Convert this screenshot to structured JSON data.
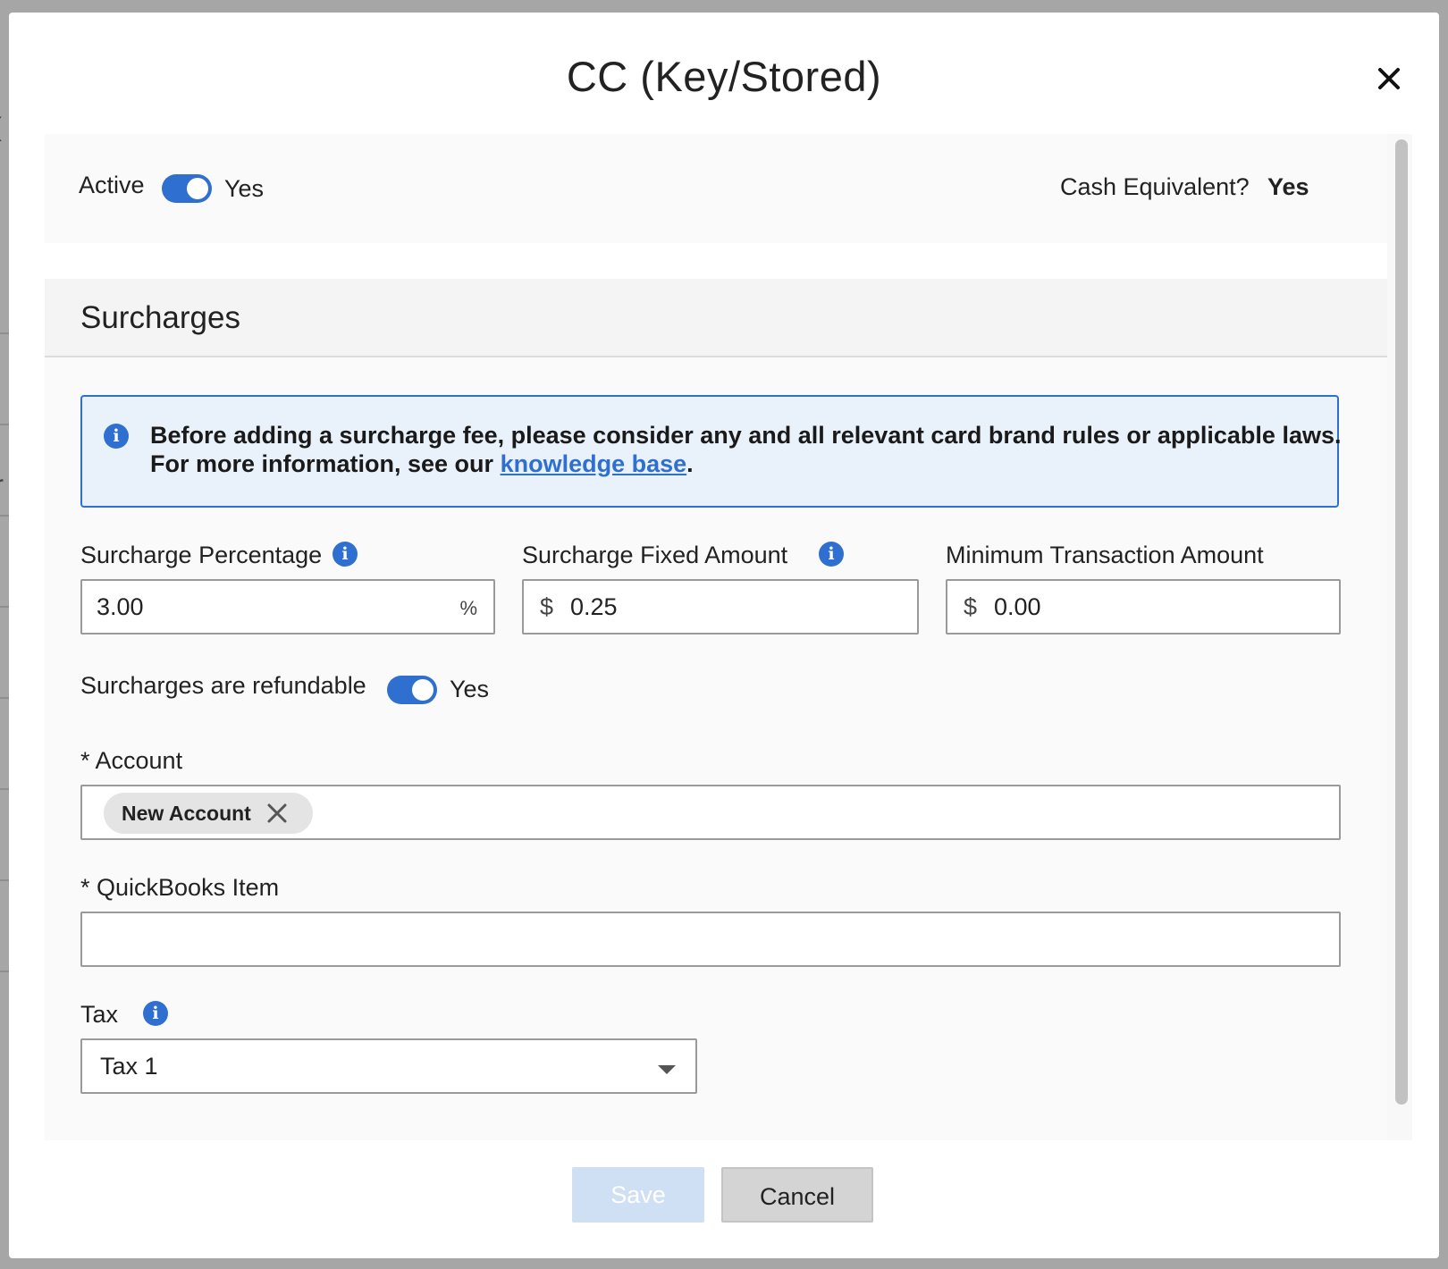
{
  "background": {
    "edge_char_1": "(",
    "edge_char_2": "r"
  },
  "dialog": {
    "title": "CC (Key/Stored)",
    "close_icon": "close-icon"
  },
  "status": {
    "active_label": "Active",
    "active_value": "Yes",
    "active_on": true,
    "cash_equivalent_label": "Cash Equivalent?",
    "cash_equivalent_value": "Yes"
  },
  "surcharges": {
    "heading": "Surcharges",
    "notice": {
      "icon": "info-icon",
      "line1": "Before adding a surcharge fee, please consider any and all relevant card brand rules or applicable laws.",
      "line2_prefix": "For more information, see our ",
      "link_text": "knowledge base",
      "line2_suffix": "."
    },
    "percentage": {
      "label": "Surcharge Percentage",
      "value": "3.00",
      "suffix": "%"
    },
    "fixed_amount": {
      "label": "Surcharge Fixed Amount",
      "prefix": "$",
      "value": "0.25"
    },
    "minimum": {
      "label": "Minimum Transaction Amount",
      "prefix": "$",
      "value": "0.00"
    },
    "refundable": {
      "label": "Surcharges are refundable",
      "value": "Yes",
      "on": true
    },
    "account": {
      "label": "* Account",
      "chip": "New Account"
    },
    "quickbooks_item": {
      "label": "* QuickBooks Item",
      "value": ""
    },
    "tax": {
      "label": "Tax",
      "value": "Tax 1"
    }
  },
  "footer": {
    "save_label": "Save",
    "cancel_label": "Cancel"
  },
  "colors": {
    "accent": "#2f6fcf",
    "notice_bg": "#e9f1fa",
    "save_disabled_bg": "#cfe0f5"
  }
}
